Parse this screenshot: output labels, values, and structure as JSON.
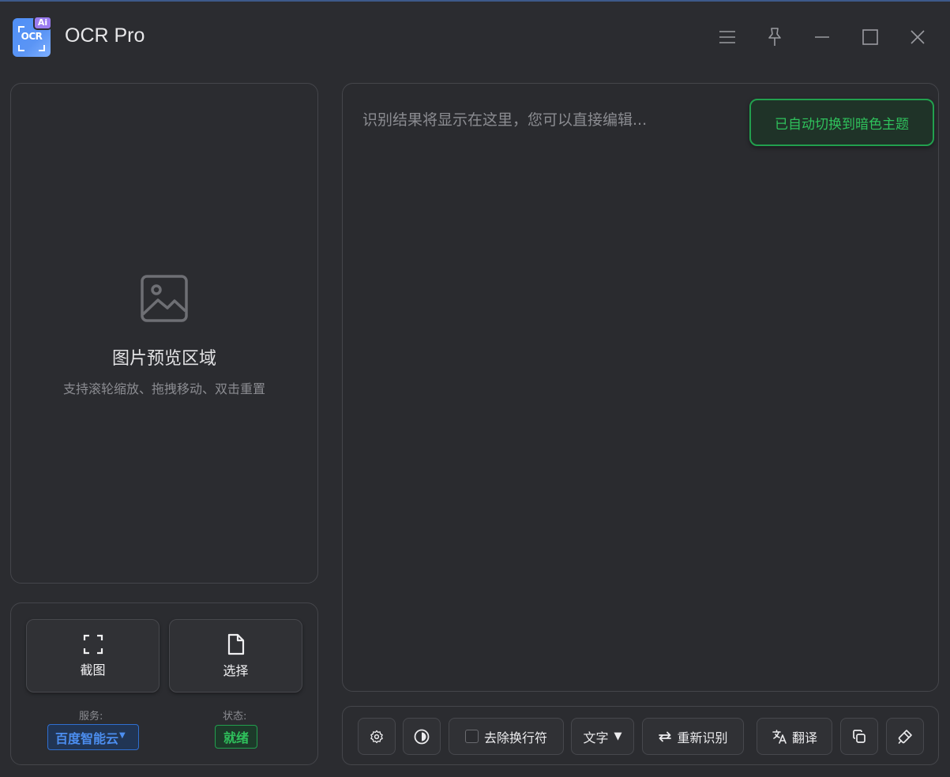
{
  "app": {
    "title": "OCR Pro",
    "logo_text": "OCR",
    "logo_badge": "Ai"
  },
  "window_controls": {
    "menu": "menu-icon",
    "pin": "pin-icon",
    "minimize": "minimize-icon",
    "maximize": "maximize-icon",
    "close": "close-icon"
  },
  "preview": {
    "title": "图片预览区域",
    "subtitle": "支持滚轮缩放、拖拽移动、双击重置"
  },
  "actions": {
    "screenshot_label": "截图",
    "select_label": "选择"
  },
  "info": {
    "service_label": "服务:",
    "service_value": "百度智能云",
    "service_arrow": "▼",
    "status_label": "状态:",
    "status_value": "就绪"
  },
  "result": {
    "placeholder": "识别结果将显示在这里，您可以直接编辑...",
    "toast": "已自动切换到暗色主题"
  },
  "toolbar": {
    "remove_newlines_label": "去除换行符",
    "remove_newlines_checked": false,
    "mode_value": "文字",
    "mode_arrow": "▼",
    "reocr_label": "重新识别",
    "translate_label": "翻译"
  },
  "colors": {
    "background": "#2b2c30",
    "border": "#45464b",
    "accent_blue": "#4c8ef0",
    "success_green": "#2fc15c",
    "logo_purple": "#9b7cf0"
  }
}
